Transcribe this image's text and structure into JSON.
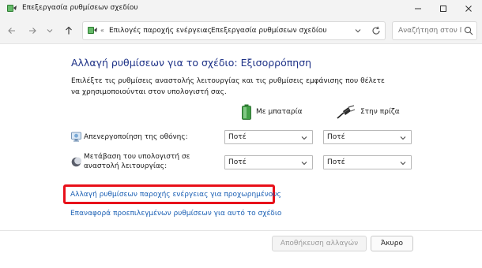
{
  "window": {
    "title": "Επεξεργασία ρυθμίσεων σχεδίου",
    "controls": {
      "minimize": "—",
      "maximize": "☐",
      "close": "✕"
    }
  },
  "nav": {
    "back": "←",
    "forward": "→",
    "recent": "⌄",
    "up": "↑",
    "breadcrumb": {
      "overflow": "«",
      "items": [
        "Επιλογές παροχής ενέργειας",
        "Επεξεργασία ρυθμίσεων σχεδίου"
      ],
      "separator": "›"
    },
    "dropdown": "⌄",
    "refresh": "↻",
    "search_placeholder": "Αναζήτηση στον Πί..."
  },
  "main": {
    "heading": "Αλλαγή ρυθμίσεων για το σχέδιο: Εξισορρόπηση",
    "description": "Επιλέξτε τις ρυθμίσεις αναστολής λειτουργίας και τις ρυθμίσεις εμφάνισης που θέλετε να χρησιμοποιούνται στον υπολογιστή σας.",
    "columns": {
      "battery": "Με μπαταρία",
      "plugged": "Στην πρίζα"
    },
    "rows": [
      {
        "label": "Απενεργοποίηση της οθόνης:",
        "battery_value": "Ποτέ",
        "plugged_value": "Ποτέ",
        "icon": "monitor-icon"
      },
      {
        "label": "Μετάβαση του υπολογιστή σε αναστολή λειτουργίας:",
        "battery_value": "Ποτέ",
        "plugged_value": "Ποτέ",
        "icon": "moon-icon"
      }
    ],
    "advanced_link": "Αλλαγή ρυθμίσεων παροχής ενέργειας για προχωρημένους",
    "restore_link": "Επαναφορά προεπιλεγμένων ρυθμίσεων για αυτό το σχέδιο"
  },
  "footer": {
    "save_label": "Αποθήκευση αλλαγών",
    "cancel_label": "Άκυρο"
  },
  "colors": {
    "heading": "#1e3287",
    "link": "#1a5fb4",
    "highlight": "#e8101a"
  }
}
